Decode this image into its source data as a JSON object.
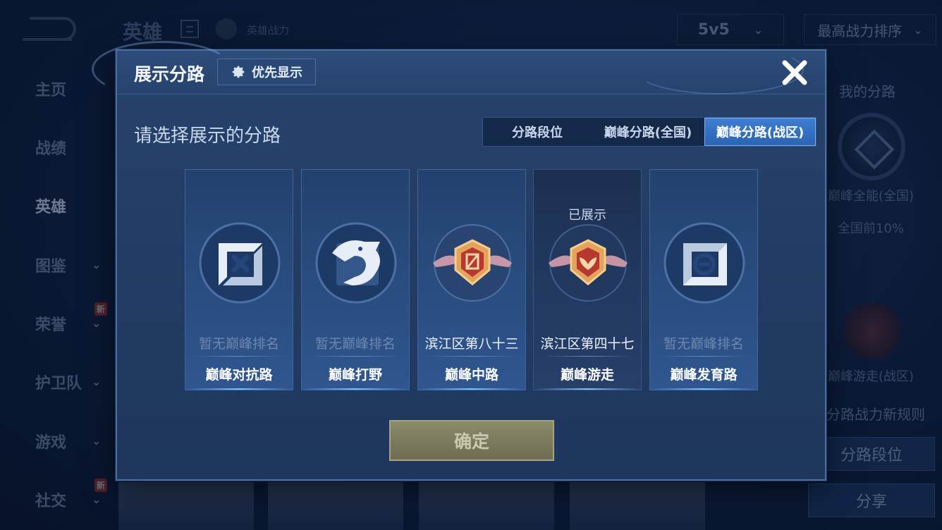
{
  "background": {
    "header": {
      "title": "英雄",
      "power_label": "英雄战力",
      "mode": "5v5",
      "sort": "最高战力排序"
    },
    "nav": [
      {
        "label": "主页",
        "has_chevron": false
      },
      {
        "label": "战绩",
        "has_chevron": false
      },
      {
        "label": "英雄",
        "has_chevron": false,
        "active": true
      },
      {
        "label": "图鉴",
        "has_chevron": true
      },
      {
        "label": "荣誉",
        "has_chevron": true,
        "badge": "新"
      },
      {
        "label": "护卫队",
        "has_chevron": true
      },
      {
        "label": "游戏",
        "has_chevron": true
      },
      {
        "label": "社交",
        "has_chevron": true,
        "badge": "新"
      }
    ],
    "right_panel": {
      "title": "我的分路",
      "lane1_name": "巅峰全能(全国)",
      "lane1_rank": "全国前10%",
      "lane2_name": "巅峰游走(战区)",
      "rule_link": "分路战力新规则",
      "lane_rank_button": "分路段位",
      "share_button": "分享"
    }
  },
  "modal": {
    "title": "展示分路",
    "priority_button": "优先显示",
    "subtitle": "请选择展示的分路",
    "tabs": [
      {
        "label": "分路段位",
        "active": false
      },
      {
        "label": "巅峰分路(全国)",
        "active": false
      },
      {
        "label": "巅峰分路(战区)",
        "active": true
      }
    ],
    "cards": [
      {
        "lane": "巅峰对抗路",
        "rank": "暂无巅峰排名",
        "ranked": false,
        "icon": "clash-lane-icon"
      },
      {
        "lane": "巅峰打野",
        "rank": "暂无巅峰排名",
        "ranked": false,
        "icon": "jungle-dragon-icon"
      },
      {
        "lane": "巅峰中路",
        "rank": "滨江区第八十三",
        "ranked": true,
        "icon": "mid-lane-badge-icon"
      },
      {
        "lane": "巅峰游走",
        "rank": "滨江区第四十七",
        "ranked": true,
        "shown": true,
        "shown_label": "已展示",
        "icon": "roam-badge-icon"
      },
      {
        "lane": "巅峰发育路",
        "rank": "暂无巅峰排名",
        "ranked": false,
        "icon": "farm-lane-icon"
      }
    ],
    "confirm_button": "确定"
  },
  "colors": {
    "modal_bg": "#24406a",
    "active_tab": "#3a78c9",
    "confirm_bg": "#7d7b5f",
    "badge_gold": "#d9a05a",
    "badge_red": "#c2413a"
  }
}
